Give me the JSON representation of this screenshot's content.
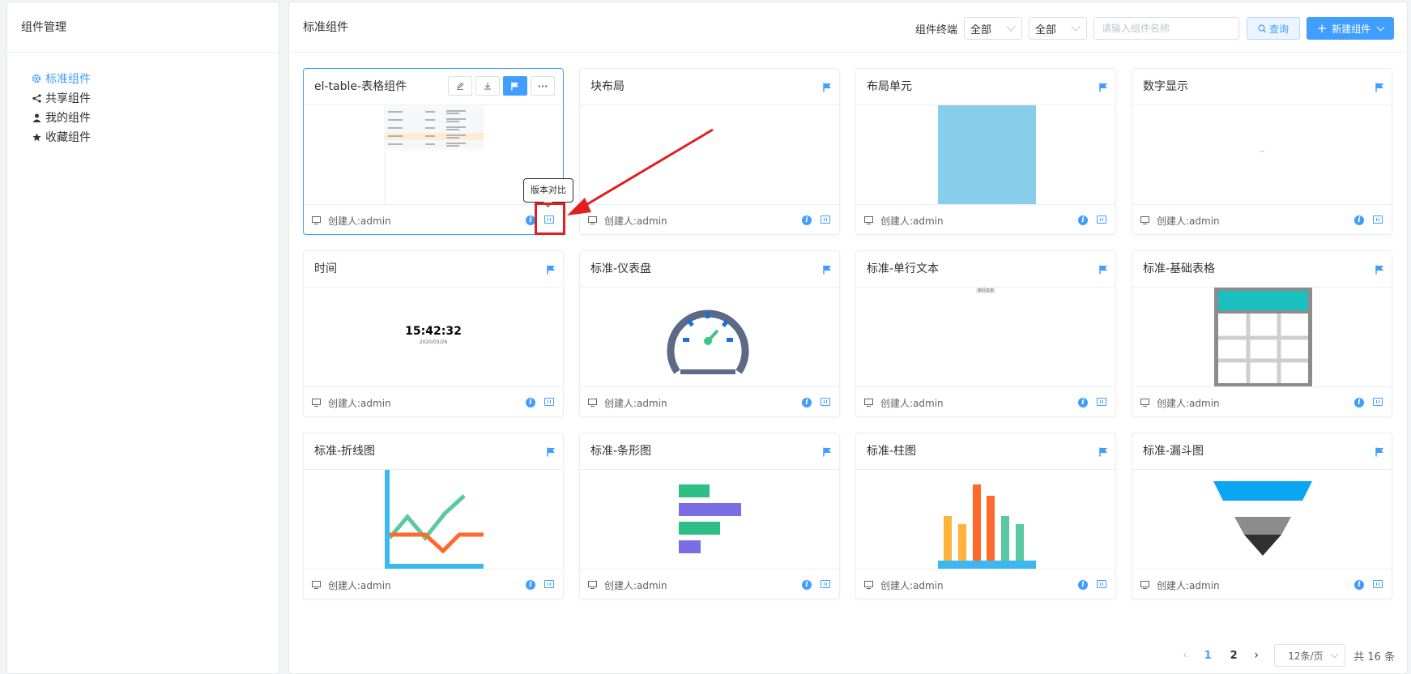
{
  "sidebar": {
    "title": "组件管理",
    "items": [
      {
        "label": "标准组件",
        "icon": "gear-icon",
        "active": true
      },
      {
        "label": "共享组件",
        "icon": "share-icon",
        "active": false
      },
      {
        "label": "我的组件",
        "icon": "user-icon",
        "active": false
      },
      {
        "label": "收藏组件",
        "icon": "star-icon",
        "active": false
      }
    ]
  },
  "main": {
    "title": "标准组件",
    "filter_label": "组件终端",
    "filter1_value": "全部",
    "filter2_value": "全部",
    "search_placeholder": "请输入组件名称",
    "query_label": "查询",
    "new_label": "新建组件"
  },
  "cards": [
    {
      "title": "el-table-表格组件",
      "creator": "创建人:admin",
      "preview": "table-screenshot"
    },
    {
      "title": "块布局",
      "creator": "创建人:admin",
      "preview": "blank"
    },
    {
      "title": "布局单元",
      "creator": "创建人:admin",
      "preview": "light-blue-block"
    },
    {
      "title": "数字显示",
      "creator": "创建人:admin",
      "preview": "number-display",
      "number_text": "--"
    },
    {
      "title": "时间",
      "creator": "创建人:admin",
      "preview": "clock",
      "time_text": "15:42:32",
      "date_text": "2020/03/26"
    },
    {
      "title": "标准-仪表盘",
      "creator": "创建人:admin",
      "preview": "gauge"
    },
    {
      "title": "标准-单行文本",
      "creator": "创建人:admin",
      "preview": "single-line-text",
      "text_tag": "单行文本"
    },
    {
      "title": "标准-基础表格",
      "creator": "创建人:admin",
      "preview": "table-grid"
    },
    {
      "title": "标准-折线图",
      "creator": "创建人:admin",
      "preview": "line-chart"
    },
    {
      "title": "标准-条形图",
      "creator": "创建人:admin",
      "preview": "horizontal-bar-chart"
    },
    {
      "title": "标准-柱图",
      "creator": "创建人:admin",
      "preview": "column-chart"
    },
    {
      "title": "标准-漏斗图",
      "creator": "创建人:admin",
      "preview": "funnel-chart"
    }
  ],
  "tooltip": {
    "text": "版本对比"
  },
  "pagination": {
    "pages": [
      "1",
      "2"
    ],
    "active_page": "1",
    "page_size": "12条/页",
    "total": "共 16 条"
  },
  "colors": {
    "primary": "#409eff",
    "highlight": "#e02020",
    "gauge": "#5a6a87",
    "green": "#3cc68a",
    "orange": "#ff6a2c",
    "cyan": "#1abfc0"
  }
}
